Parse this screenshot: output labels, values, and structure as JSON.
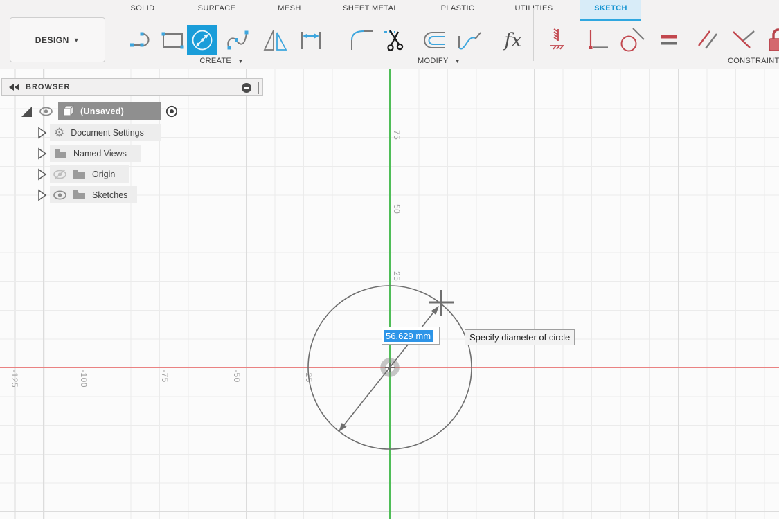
{
  "colors": {
    "accent_blue": "#1a9dd9",
    "active_tab_bg": "#d8ecf8",
    "constraint_red": "#c2474e",
    "axis_green": "#4fbd57",
    "axis_red": "#ea8282",
    "selection_blue": "#2e95e8"
  },
  "ribbon": {
    "context_button": {
      "label": "DESIGN"
    },
    "tabs": [
      {
        "label": "SOLID",
        "active": false
      },
      {
        "label": "SURFACE",
        "active": false
      },
      {
        "label": "MESH",
        "active": false
      },
      {
        "label": "SHEET METAL",
        "active": false
      },
      {
        "label": "PLASTIC",
        "active": false
      },
      {
        "label": "UTILITIES",
        "active": false
      },
      {
        "label": "SKETCH",
        "active": true
      }
    ],
    "groups": [
      {
        "label": "CREATE",
        "dropdown": true
      },
      {
        "label": "MODIFY",
        "dropdown": true
      },
      {
        "label": "CONSTRAINTS",
        "dropdown": false
      }
    ],
    "tools": {
      "create": [
        "line",
        "rectangle",
        "circle-center-diameter",
        "spline",
        "mirror",
        "sketch-dimension"
      ],
      "modify": [
        "fillet",
        "trim",
        "offset",
        "extend",
        "change-parameters-fx"
      ],
      "constraints": [
        "fix-unfix",
        "horizontal-vertical",
        "tangent",
        "equal",
        "parallel",
        "perpendicular",
        "sketch-lock"
      ],
      "active_tool": "circle-center-diameter"
    }
  },
  "browser": {
    "title": "BROWSER",
    "root": {
      "label": "(Unsaved)",
      "visible": true,
      "selected": true,
      "expanded": true
    },
    "items": [
      {
        "label": "Document Settings",
        "icon": "gear",
        "visibility": "none"
      },
      {
        "label": "Named Views",
        "icon": "folder",
        "visibility": "none"
      },
      {
        "label": "Origin",
        "icon": "folder",
        "visibility": "hidden"
      },
      {
        "label": "Sketches",
        "icon": "folder",
        "visibility": "visible"
      }
    ]
  },
  "canvas": {
    "vticks": [
      "75",
      "50",
      "25"
    ],
    "hticks": [
      "-125",
      "-100",
      "-75",
      "-50",
      "-25"
    ],
    "dimension_input": {
      "value": "56.629 mm",
      "selected": true
    },
    "tooltip": "Specify diameter of circle",
    "sketch": {
      "shape": "circle",
      "diameter_mm": 56.629
    }
  }
}
